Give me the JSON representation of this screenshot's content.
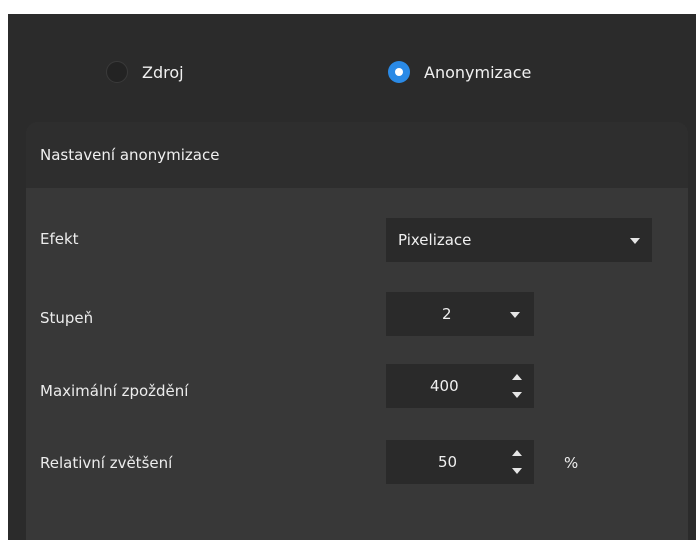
{
  "source_mode": {
    "options": [
      {
        "label": "Zdroj",
        "selected": false
      },
      {
        "label": "Anonymizace",
        "selected": true
      }
    ]
  },
  "panel": {
    "title": "Nastavení anonymizace",
    "effect": {
      "label": "Efekt",
      "value": "Pixelizace"
    },
    "degree": {
      "label": "Stupeň",
      "value": "2"
    },
    "max_delay": {
      "label": "Maximální zpoždění",
      "value": "400"
    },
    "relative_zoom": {
      "label": "Relativní zvětšení",
      "value": "50",
      "unit": "%"
    }
  },
  "colors": {
    "background": "#2b2b2b",
    "panel": "#383838",
    "panel_header": "#2e2e2e",
    "control": "#2a2a2a",
    "accent": "#2a8ae6"
  }
}
